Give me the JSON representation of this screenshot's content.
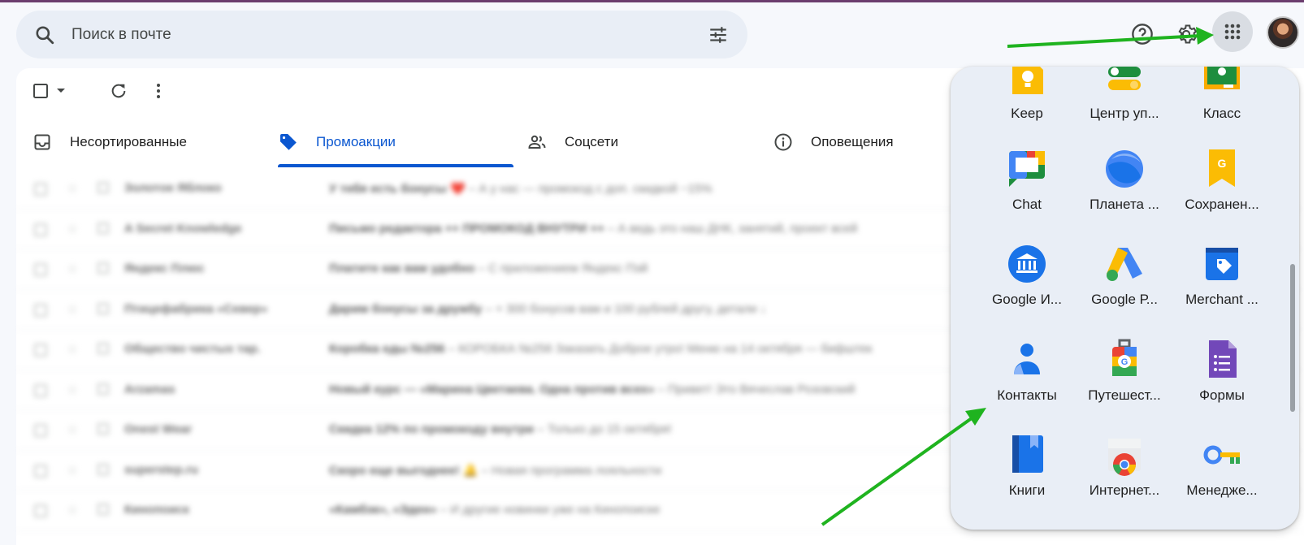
{
  "search": {
    "placeholder": "Поиск в почте"
  },
  "tabs": [
    {
      "label": "Несортированные",
      "icon": "inbox-icon"
    },
    {
      "label": "Промоакции",
      "icon": "tag-icon",
      "active": true
    },
    {
      "label": "Соцсети",
      "icon": "people-icon"
    },
    {
      "label": "Оповещения",
      "icon": "info-icon"
    }
  ],
  "emails": [
    {
      "sender": "Золотое Яблоко",
      "subject": "У тебя есть бонусы ❤️",
      "snippet": " – А у нас — промокод с доп. скидкой −15%"
    },
    {
      "sender": "A Secret Knowledge",
      "subject": "Письмо редактора ++ ПРОМОКОД ВНУТРИ ++",
      "snippet": " – А ведь это наш ДНК, занятий, проект всей"
    },
    {
      "sender": "Яндекс Плюс",
      "subject": "Платите как вам удобно",
      "snippet": " – С приложением Яндекс Пэй"
    },
    {
      "sender": "Птицефабрика «Север»",
      "subject": "Дарим бонусы за дружбу",
      "snippet": " – + 300 бонусов вам и 100 рублей другу, детали ↓"
    },
    {
      "sender": "Общество чистых тар.",
      "subject": "Коробка еды №256",
      "snippet": " – КОРОБКА №256 Заказать Доброе утро! Меню на 14 октября — бифштек"
    },
    {
      "sender": "Arzamas",
      "subject": "Новый курс — «Марина Цветаева. Одна против всех»",
      "snippet": " – Привет! Это Вячеслав Розовский"
    },
    {
      "sender": "Onest Wear",
      "subject": "Скидка 12% по промокоду внутри",
      "snippet": " – Только до 15 октября!"
    },
    {
      "sender": "superstep.ru",
      "subject": "Скоро еще выгоднее! 🔔",
      "snippet": " – Новая программа лояльности"
    },
    {
      "sender": "Кинопоиск",
      "subject": "«Камбэк», «Эден»",
      "snippet": " – И другие новинки уже на Кинопоиске"
    }
  ],
  "apps": [
    {
      "label": "Keep",
      "icon": "keep-icon"
    },
    {
      "label": "Центр уп...",
      "icon": "admin-center-icon"
    },
    {
      "label": "Класс",
      "icon": "classroom-icon"
    },
    {
      "label": "Chat",
      "icon": "chat-icon"
    },
    {
      "label": "Планета ...",
      "icon": "earth-icon"
    },
    {
      "label": "Сохранен...",
      "icon": "saved-icon"
    },
    {
      "label": "Google И...",
      "icon": "arts-culture-icon"
    },
    {
      "label": "Google Р...",
      "icon": "google-ads-icon"
    },
    {
      "label": "Merchant ...",
      "icon": "merchant-center-icon"
    },
    {
      "label": "Контакты",
      "icon": "contacts-icon"
    },
    {
      "label": "Путешест...",
      "icon": "travel-icon"
    },
    {
      "label": "Формы",
      "icon": "forms-icon"
    },
    {
      "label": "Книги",
      "icon": "books-icon"
    },
    {
      "label": "Интернет...",
      "icon": "chrome-web-store-icon"
    },
    {
      "label": "Менедже...",
      "icon": "password-manager-icon"
    }
  ],
  "colors": {
    "accent": "#0b57d0",
    "arrow": "#1fb31f",
    "search_bg": "#e9eef6"
  }
}
